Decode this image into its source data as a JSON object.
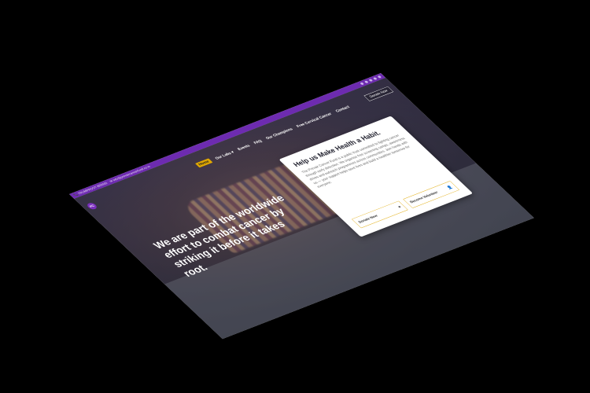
{
  "topbar": {
    "phone": "📞 TRUMPROOT BRAND",
    "email": "✉ info@prevaircancerfund.co.in",
    "social": [
      "facebook-icon",
      "twitter-icon",
      "instagram-icon",
      "youtube-icon",
      "linkedin-icon"
    ]
  },
  "logo": {
    "label": "PC"
  },
  "nav": {
    "items": [
      "Home",
      "Our Labs ▾",
      "Events",
      "FAQ",
      "Our Champions",
      "Free Cervical Cancer",
      "Contact"
    ]
  },
  "header": {
    "donate_label": "Donate Now"
  },
  "hero": {
    "headline": "We are part of the worldwide effort to combat cancer by striking it before it takes root."
  },
  "card": {
    "title": "Help us Make Health a Habit.",
    "body": "The Prevair Cancer Fund is a public trust committed to fighting cancer through early detection. We organise free screening camps, awareness drives and outreach programmes across communities. Join hands with us — your support helps save lives and build a healthier tomorrow for everyone.",
    "donate_label": "Donate Now",
    "volunteer_label": "Become Volunteer"
  },
  "colors": {
    "brand": "#6d2bb0",
    "accent": "#e0a800"
  }
}
